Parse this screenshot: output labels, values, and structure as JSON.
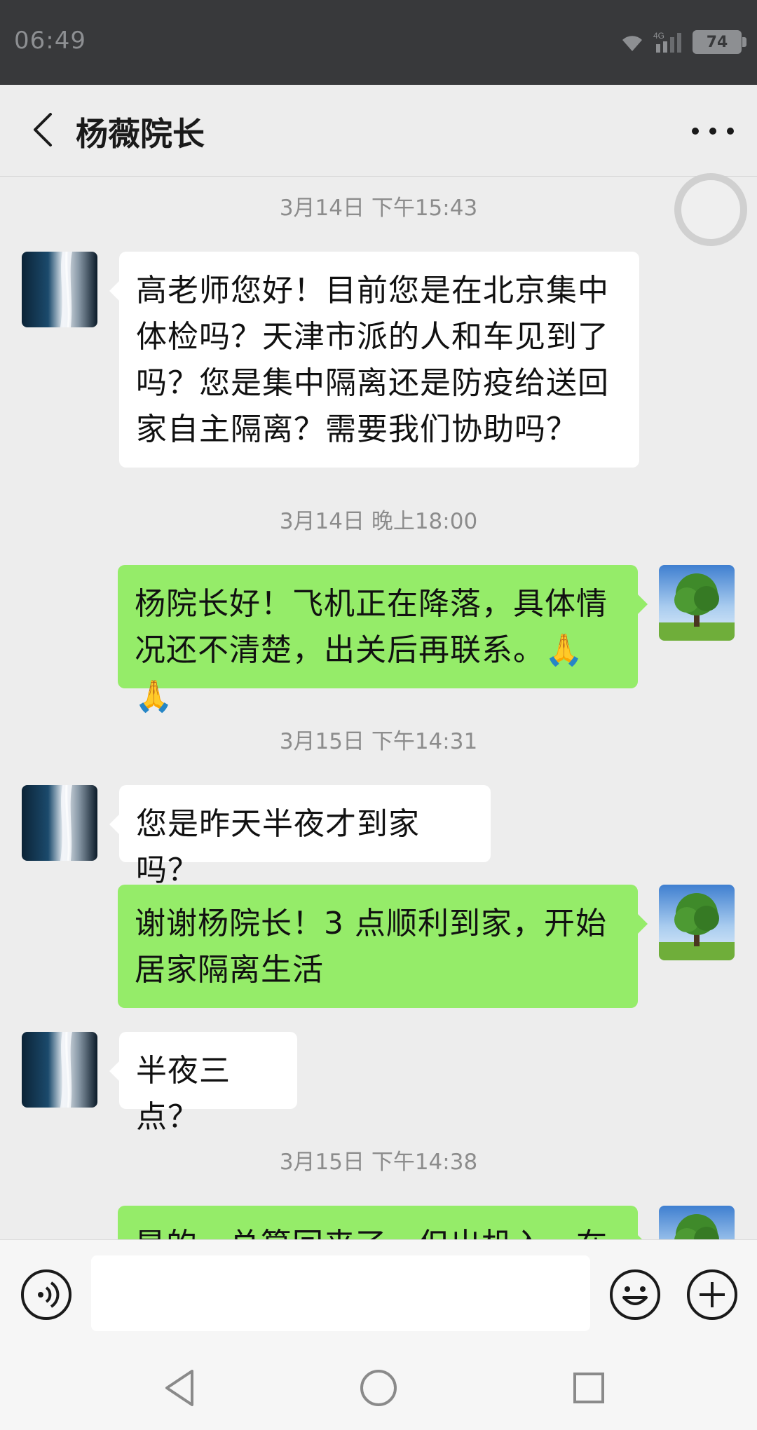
{
  "status_bar": {
    "time": "06:49",
    "network": "4G",
    "battery": "74"
  },
  "header": {
    "title": "杨薇院长",
    "back_icon": "chevron-left-icon",
    "more_icon": "more-horizontal-icon"
  },
  "messages": [
    {
      "type": "time",
      "text": "3月14日 下午15:43"
    },
    {
      "type": "msg",
      "side": "left",
      "text": "高老师您好！目前您是在北京集中体检吗？天津市派的人和车见到了吗？您是集中隔离还是防疫给送回家自主隔离？需要我们协助吗？"
    },
    {
      "type": "time",
      "text": "3月14日 晚上18:00"
    },
    {
      "type": "msg",
      "side": "right",
      "text": "杨院长好！飞机正在降落，具体情况还不清楚，出关后再联系。🙏🙏"
    },
    {
      "type": "time",
      "text": "3月15日 下午14:31"
    },
    {
      "type": "msg",
      "side": "left",
      "text": "您是昨天半夜才到家吗？"
    },
    {
      "type": "msg",
      "side": "right",
      "text": "谢谢杨院长！3 点顺利到家，开始居家隔离生活"
    },
    {
      "type": "msg",
      "side": "left",
      "text": "半夜三点？"
    },
    {
      "type": "time",
      "text": "3月15日 下午14:38"
    },
    {
      "type": "msg",
      "side": "right",
      "text": "是的，总算回来了，但出机入，在"
    }
  ],
  "input_bar": {
    "voice_icon": "voice-icon",
    "input_value": "",
    "emoji_icon": "emoji-icon",
    "plus_icon": "plus-icon"
  },
  "nav_bar": {
    "back_icon": "triangle-back-icon",
    "home_icon": "circle-home-icon",
    "recents_icon": "square-recents-icon"
  },
  "colors": {
    "status_bar_bg": "#38393b",
    "background": "#ededed",
    "bubble_self": "#95ec69",
    "bubble_other": "#ffffff",
    "timestamp_text": "#8c8c8c"
  }
}
